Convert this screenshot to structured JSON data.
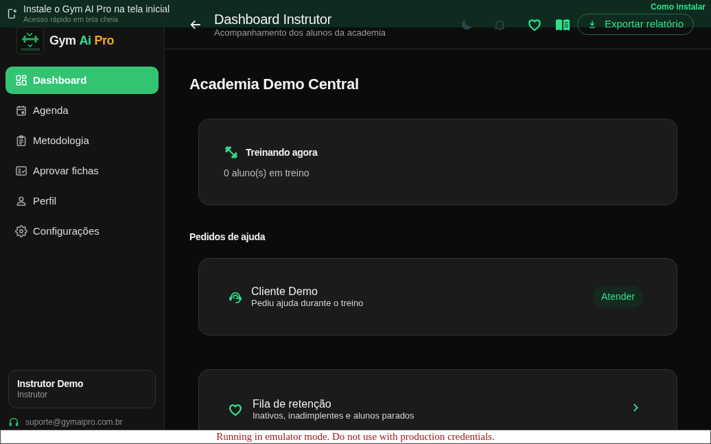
{
  "install_banner": {
    "title": "Instale o Gym AI Pro na tela inicial",
    "subtitle": "Acesso rápido em tela cheia",
    "link": "Como instalar"
  },
  "sidebar": {
    "brand": [
      {
        "text": "Gym",
        "color": "#e6e6e6"
      },
      {
        "text": "Ai",
        "color": "#2fe08a"
      },
      {
        "text": "Pro",
        "color": "#f6a51f"
      }
    ],
    "nav": [
      {
        "label": "Dashboard",
        "selected": true
      },
      {
        "label": "Agenda",
        "selected": false
      },
      {
        "label": "Metodologia",
        "selected": false
      },
      {
        "label": "Aprovar fichas",
        "selected": false
      },
      {
        "label": "Perfil",
        "selected": false
      },
      {
        "label": "Configurações",
        "selected": false
      }
    ],
    "user": {
      "name": "Instrutor Demo",
      "role": "Instrutor"
    },
    "support_email": "suporte@gymaipro.com.br"
  },
  "header": {
    "title": "Dashboard Instrutor",
    "subtitle": "Acompanhamento dos alunos da academia",
    "export_button": "Exportar relatório"
  },
  "main": {
    "title": "Academia Demo Central",
    "training_card": {
      "title": "Treinando agora",
      "detail": "0 aluno(s) em treino"
    },
    "help_section": {
      "title": "Pedidos de ajuda",
      "requests": [
        {
          "name": "Cliente Demo",
          "detail": "Pediu ajuda durante o treino",
          "action": "Atender"
        }
      ]
    },
    "retention_card": {
      "title": "Fila de retenção",
      "detail": "Inativos, inadimplentes e alunos parados"
    }
  },
  "emulator_notice": "Running in emulator mode. Do not use with production credentials."
}
